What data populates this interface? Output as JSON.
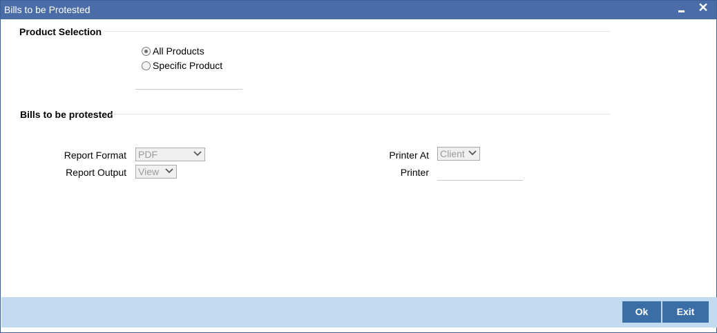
{
  "window": {
    "title": "Bills to be Protested",
    "minimize_icon": "minimize-icon",
    "close_glyph": "✕"
  },
  "product_selection": {
    "heading": "Product Selection",
    "options": [
      {
        "label": "All Products",
        "checked": true
      },
      {
        "label": "Specific Product",
        "checked": false
      }
    ],
    "product_code_value": ""
  },
  "bills_section": {
    "heading": "Bills to be protested",
    "report_format_label": "Report Format",
    "report_format_value": "PDF",
    "report_output_label": "Report Output",
    "report_output_value": "View",
    "printer_at_label": "Printer At",
    "printer_at_value": "Client",
    "printer_label": "Printer",
    "printer_value": ""
  },
  "footer": {
    "ok_label": "Ok",
    "exit_label": "Exit"
  },
  "colors": {
    "titlebar": "#4a6da8",
    "footer": "#c1daf0",
    "button": "#3c6ea6"
  }
}
